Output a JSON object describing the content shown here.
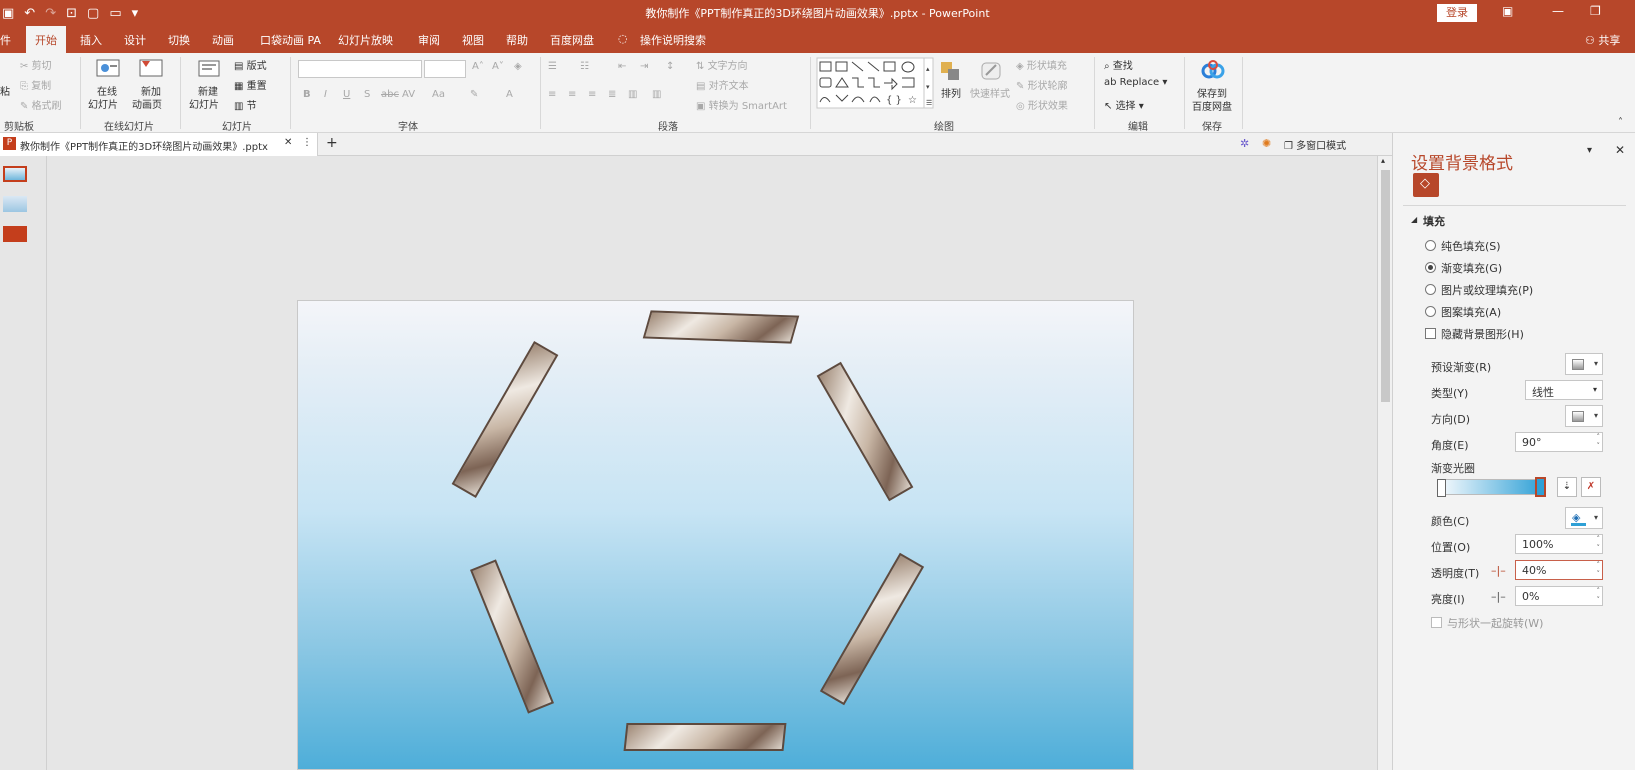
{
  "titlebar": {
    "title": "教你制作《PPT制作真正的3D环绕图片动画效果》.pptx  -  PowerPoint",
    "login": "登录",
    "app_color": "#b7472a"
  },
  "tabs": {
    "file": "件",
    "home": "开始",
    "insert": "插入",
    "design": "设计",
    "transitions": "切换",
    "animations": "动画",
    "pocket": "口袋动画 PA",
    "slideshow": "幻灯片放映",
    "review": "审阅",
    "view": "视图",
    "help": "帮助",
    "baidu": "百度网盘",
    "search": "操作说明搜索",
    "share": "共享"
  },
  "ribbon": {
    "clipboard": {
      "paste": "粘",
      "cut": "剪切",
      "copy": "复制",
      "painter": "格式刷",
      "label": "剪贴板"
    },
    "online": {
      "btn_line1": "在线",
      "btn_line2": "幻灯片",
      "new_line1": "新加",
      "new_line2": "动画页",
      "label": "在线幻灯片"
    },
    "slides": {
      "new_line1": "新建",
      "new_line2": "幻灯片",
      "layout": "版式",
      "reset": "重置",
      "section": "节",
      "label": "幻灯片"
    },
    "font": {
      "bold": "B",
      "italic": "I",
      "underline": "U",
      "shadow": "S",
      "strike": "abc",
      "spacing": "AV",
      "case": "Aa",
      "label": "字体"
    },
    "paragraph": {
      "text_dir": "文字方向",
      "align_text": "对齐文本",
      "smartart": "转换为 SmartArt",
      "label": "段落"
    },
    "drawing": {
      "arrange": "排列",
      "quick_styles": "快速样式",
      "fill": "形状填充",
      "outline": "形状轮廓",
      "effects": "形状效果",
      "label": "绘图"
    },
    "editing": {
      "find": "查找",
      "replace": "Replace",
      "select": "选择",
      "label": "编辑"
    },
    "save": {
      "line1": "保存到",
      "line2": "百度网盘",
      "label": "保存"
    }
  },
  "document": {
    "tab_name": "教你制作《PPT制作真正的3D环绕图片动画效果》.pptx",
    "multi_window": "多窗口模式"
  },
  "pane": {
    "title": "设置背景格式",
    "section": "填充",
    "options": {
      "solid": "纯色填充(S)",
      "gradient": "渐变填充(G)",
      "picture": "图片或纹理填充(P)",
      "pattern": "图案填充(A)"
    },
    "hide_bg": "隐藏背景图形(H)",
    "preset": "预设渐变(R)",
    "type_label": "类型(Y)",
    "type_value": "线性",
    "direction": "方向(D)",
    "angle_label": "角度(E)",
    "angle_value": "90°",
    "stops_label": "渐变光圈",
    "color_label": "颜色(C)",
    "position_label": "位置(O)",
    "position_value": "100%",
    "transparency_label": "透明度(T)",
    "transparency_value": "40%",
    "brightness_label": "亮度(I)",
    "brightness_value": "0%",
    "rotate_with_shape": "与形状一起旋转(W)"
  }
}
